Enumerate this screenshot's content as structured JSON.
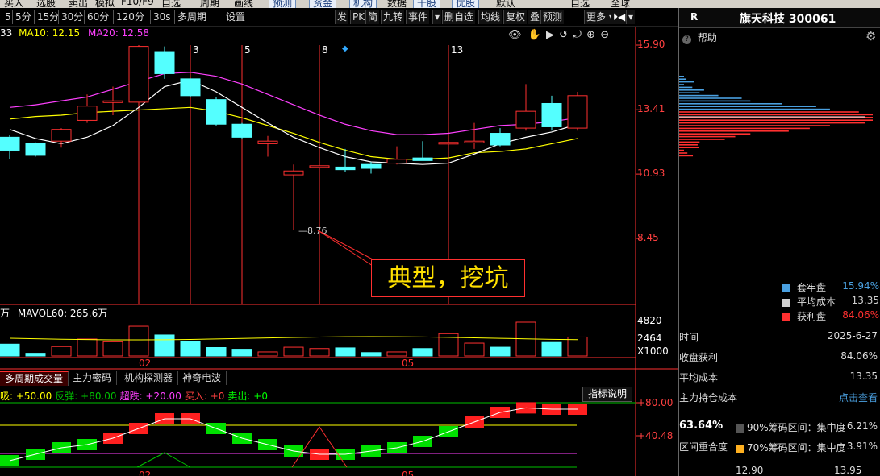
{
  "top_menu": [
    "买入",
    "选股",
    "卖出",
    "模拟",
    "F10/F9",
    "自选",
    "周期",
    "画线",
    "预测",
    "资金",
    "机构",
    "数据",
    "千股",
    "优股",
    "默认",
    "自选",
    "全球"
  ],
  "periods": [
    "5",
    "5分",
    "15分",
    "30分",
    "60分",
    "120分",
    "30s",
    "多周期",
    "设置"
  ],
  "right_tools": [
    "发",
    "PK",
    "简",
    "九转",
    "事件",
    "删自选",
    "均线",
    "复权",
    "叠",
    "预测",
    "更多"
  ],
  "ma_legend": {
    "ma5_value": "33",
    "ma10_label": "MA10: 12.15",
    "ma20_label": "MA20: 12.58"
  },
  "candles": [
    {
      "o": 12.35,
      "h": 12.45,
      "l": 11.5,
      "c": 11.85,
      "up": false
    },
    {
      "o": 12.1,
      "h": 12.15,
      "l": 11.6,
      "c": 11.65,
      "up": false
    },
    {
      "o": 12.2,
      "h": 12.7,
      "l": 11.95,
      "c": 12.65,
      "up": true
    },
    {
      "o": 13.0,
      "h": 14.0,
      "l": 12.9,
      "c": 13.55,
      "up": true
    },
    {
      "o": 13.75,
      "h": 14.3,
      "l": 13.2,
      "c": 13.75,
      "up": true
    },
    {
      "o": 13.7,
      "h": 15.85,
      "l": 13.6,
      "c": 15.85,
      "up": true
    },
    {
      "o": 15.65,
      "h": 15.85,
      "l": 14.6,
      "c": 14.8,
      "up": false
    },
    {
      "o": 14.6,
      "h": 14.6,
      "l": 13.9,
      "c": 13.95,
      "up": false
    },
    {
      "o": 13.8,
      "h": 13.9,
      "l": 12.8,
      "c": 12.85,
      "up": false
    },
    {
      "o": 12.85,
      "h": 12.9,
      "l": 12.3,
      "c": 12.35,
      "up": false
    },
    {
      "o": 12.1,
      "h": 12.4,
      "l": 11.6,
      "c": 12.2,
      "up": true
    },
    {
      "o": 10.9,
      "h": 11.3,
      "l": 8.76,
      "c": 11.05,
      "up": true
    },
    {
      "o": 11.25,
      "h": 11.6,
      "l": 11.0,
      "c": 11.25,
      "up": true
    },
    {
      "o": 11.2,
      "h": 11.9,
      "l": 11.0,
      "c": 11.1,
      "up": false
    },
    {
      "o": 11.3,
      "h": 11.4,
      "l": 10.95,
      "c": 11.15,
      "up": false
    },
    {
      "o": 11.35,
      "h": 12.0,
      "l": 11.3,
      "c": 11.5,
      "up": true
    },
    {
      "o": 11.55,
      "h": 12.2,
      "l": 11.45,
      "c": 11.45,
      "up": false
    },
    {
      "o": 12.15,
      "h": 12.3,
      "l": 11.4,
      "c": 12.15,
      "up": true
    },
    {
      "o": 12.2,
      "h": 12.9,
      "l": 11.9,
      "c": 12.2,
      "up": true
    },
    {
      "o": 12.5,
      "h": 12.7,
      "l": 12.0,
      "c": 12.05,
      "up": false
    },
    {
      "o": 12.7,
      "h": 14.4,
      "l": 12.6,
      "c": 13.35,
      "up": true
    },
    {
      "o": 13.65,
      "h": 13.95,
      "l": 12.6,
      "c": 12.75,
      "up": false
    },
    {
      "o": 12.7,
      "h": 14.1,
      "l": 12.6,
      "c": 13.95,
      "up": true
    }
  ],
  "ma10": [
    12.65,
    12.3,
    12.1,
    12.35,
    12.8,
    13.5,
    14.3,
    14.55,
    14.1,
    13.5,
    12.9,
    12.35,
    11.95,
    11.6,
    11.4,
    11.35,
    11.3,
    11.35,
    11.7,
    12.1,
    12.35,
    12.55,
    12.85
  ],
  "ma20": [
    13.5,
    13.6,
    13.75,
    13.9,
    14.2,
    14.5,
    14.8,
    14.85,
    14.7,
    14.4,
    14.0,
    13.6,
    13.2,
    12.85,
    12.6,
    12.45,
    12.45,
    12.5,
    12.65,
    12.8,
    12.85,
    12.95,
    13.1
  ],
  "ma5": [
    13.05,
    13.15,
    13.2,
    13.3,
    13.35,
    13.4,
    13.45,
    13.5,
    13.35,
    13.1,
    12.8,
    12.5,
    12.15,
    11.85,
    11.6,
    11.5,
    11.5,
    11.55,
    11.75,
    11.8,
    11.9,
    12.1,
    12.3
  ],
  "price_axis": [
    "15.90",
    "13.41",
    "10.93",
    "8.45"
  ],
  "event_markers": [
    "3",
    "5",
    "8",
    "13"
  ],
  "low_label": "8.76",
  "callout_text": "典型，挖坑",
  "volume": {
    "legend_head": "万",
    "mavol_label": "MAVOL60: 265.6万",
    "axis": [
      "4820",
      "2464",
      "X1000"
    ],
    "bars": [
      0.35,
      0.08,
      0.28,
      0.5,
      0.42,
      0.88,
      0.62,
      0.42,
      0.25,
      0.2,
      0.12,
      0.26,
      0.22,
      0.24,
      0.1,
      0.12,
      0.22,
      0.66,
      0.38,
      0.26,
      1.0,
      0.4,
      0.56
    ],
    "months": [
      "02",
      "05"
    ]
  },
  "indicator_tabs": [
    "多周期成交量",
    "主力密码",
    "机构探测器",
    "神奇电波"
  ],
  "indicator_legend": [
    {
      "text": "吸: +50.00",
      "color": "#ffff00"
    },
    {
      "text": "反弹: +80.00",
      "color": "#00c000"
    },
    {
      "text": "超跌: +20.00",
      "color": "#ff40ff"
    },
    {
      "text": "买入: +0",
      "color": "#ff4040"
    },
    {
      "text": "卖出: +0",
      "color": "#00ff00"
    }
  ],
  "indicator_button": "指标说明",
  "indicator_axis": [
    "+80.00",
    "+40.48"
  ],
  "indicator_bars": [
    0.1,
    0.2,
    0.3,
    0.35,
    0.45,
    0.6,
    0.75,
    0.75,
    0.6,
    0.45,
    0.35,
    0.25,
    0.2,
    0.2,
    0.25,
    0.3,
    0.4,
    0.55,
    0.7,
    0.85,
    0.92,
    0.9,
    0.9
  ],
  "indicator_up": [
    false,
    false,
    false,
    false,
    true,
    true,
    true,
    true,
    false,
    false,
    false,
    false,
    true,
    false,
    false,
    false,
    false,
    false,
    true,
    true,
    true,
    true,
    true
  ],
  "indicator_months": [
    "02",
    "05"
  ],
  "sidebar": {
    "r_label": "R",
    "stock_title": "旗天科技 300061",
    "help_label": "帮助",
    "legend": [
      {
        "label": "套牢盘",
        "value": "15.94%",
        "color": "#4aa0e0",
        "vcolor": "#4aa0e0"
      },
      {
        "label": "平均成本",
        "value": "13.35",
        "color": "#d0d0d0",
        "vcolor": "#d0d0d0"
      },
      {
        "label": "获利盘",
        "value": "84.06%",
        "color": "#ff3030",
        "vcolor": "#ff3030"
      }
    ],
    "stats": [
      {
        "label": "时间",
        "value": "2025-6-27"
      },
      {
        "label": "收盘获利",
        "value": "84.06%"
      },
      {
        "label": "平均成本",
        "value": "13.35"
      },
      {
        "label": "主力持仓成本",
        "value": "点击查看"
      }
    ],
    "concentration_pct": "63.64%",
    "concentration_label": "区间重合度",
    "ranges": [
      {
        "label": "90%筹码区间：集中度",
        "value": "6.21%",
        "color": "#555555"
      },
      {
        "label": "70%筹码区间：集中度",
        "value": "3.91%",
        "color": "#ffb020"
      }
    ],
    "bottom_values": [
      "12.90",
      "13.95"
    ]
  }
}
